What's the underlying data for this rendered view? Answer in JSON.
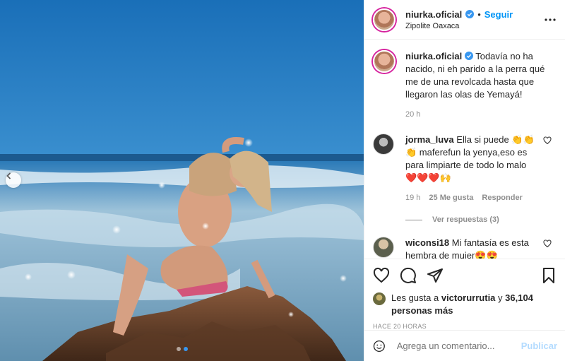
{
  "post": {
    "username": "niurka.oficial",
    "follow_label": "Seguir",
    "separator": "•",
    "location": "Zipolite Oaxaca",
    "more_icon": "more-horizontal-icon"
  },
  "caption": {
    "username": "niurka.oficial",
    "text": "Todavía no ha nacido, ni eh parido a la perra qué me de una revolcada hasta que llegaron las olas de Yemayá!",
    "time": "20 h"
  },
  "comments": [
    {
      "username": "jorma_luva",
      "text": "Ella si puede 👏👏👏 maferefun la yenya,eso es para limpiarte de todo lo malo ❤️❤️❤️🙌",
      "time": "19 h",
      "likes": "25 Me gusta",
      "reply_label": "Responder"
    },
    {
      "username": "wiconsi18",
      "text": "Mi fantasía es esta hembra de mujer😍😍"
    }
  ],
  "view_replies": "Ver respuestas (3)",
  "likes": {
    "prefix": "Les gusta a",
    "user": "victorurrutia",
    "joiner": "y",
    "count": "36,104 personas más"
  },
  "posted_ago": "HACE 20 HORAS",
  "comment_box": {
    "placeholder": "Agrega un comentario...",
    "post_label": "Publicar"
  },
  "colors": {
    "accent": "#0095f6",
    "post_disabled": "#b3dbff",
    "meta_gray": "#8e8e8e",
    "text": "#262626"
  }
}
